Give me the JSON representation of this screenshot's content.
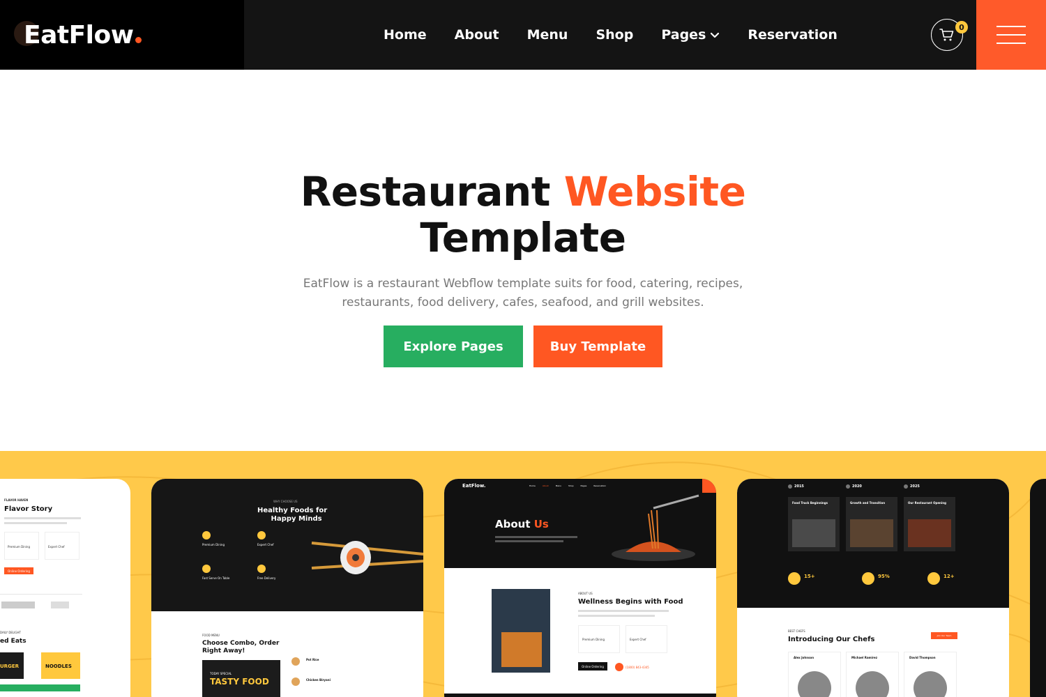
{
  "brand": {
    "logo": "EatFlow",
    "accent_color": "#ff5722"
  },
  "nav": {
    "home": "Home",
    "about": "About",
    "menu": "Menu",
    "shop": "Shop",
    "pages": "Pages",
    "reservation": "Reservation"
  },
  "cart": {
    "count": "0"
  },
  "hero": {
    "title_part1": "Restaurant ",
    "title_accent": "Website",
    "title_part2": "Template",
    "description": "EatFlow is a restaurant Webflow template suits for food, catering, recipes, restaurants, food delivery, cafes, seafood, and grill websites.",
    "explore_button": "Explore Pages",
    "buy_button": "Buy Template"
  },
  "colors": {
    "green": "#27ae60",
    "orange": "#ff5722",
    "yellow": "#ffc94a",
    "dark": "#141414"
  },
  "previews": {
    "card1": {
      "eyebrow": "FLAVOR HAVEN",
      "title": "Flavor Story",
      "feature1": "Premium Dining",
      "feature2": "Expert Chef",
      "cta": "Online Ordering",
      "eyebrow2": "DAILY DELIGHT",
      "title2": "ed Eats",
      "promo1": "URGER",
      "promo2": "NOODLES"
    },
    "card2": {
      "eyebrow": "WHY CHOOSE US",
      "title_line1": "Healthy Foods for",
      "title_line2": "Happy Minds",
      "feature1": "Premium Dining",
      "feature2": "Expert Chef",
      "feature3": "Fast Serve On Table",
      "feature4": "Free Delivery",
      "eyebrow2": "FOOD MENU",
      "title2_line1": "Choose Combo, Order",
      "title2_line2": "Right Away!",
      "promo_small": "TODAY SPECIAL",
      "promo_big": "TASTY FOOD",
      "item1": "Pot Rice",
      "item2": "Chicken Biryani"
    },
    "card3": {
      "logo": "EatFlow.",
      "nav": [
        "Home",
        "About",
        "Menu",
        "Shop",
        "Pages",
        "Reservation"
      ],
      "title": "About",
      "title_accent": "Us",
      "eyebrow2": "ABOUT US",
      "title2": "Wellness Begins with Food",
      "feature1": "Premium Dining",
      "feature2": "Expert Chef",
      "cta": "Online Ordering",
      "phone": "(1800) 843-4345"
    },
    "card4": {
      "year1": "2015",
      "year2": "2020",
      "year3": "2025",
      "step1": "Food Truck Beginnings",
      "step2": "Growth and Transition",
      "step3": "Our Restaurant Opening",
      "stat1": "15+",
      "stat2": "95%",
      "stat3": "12+",
      "eyebrow2": "BEST CHEFS",
      "title2": "Introducing Our Chefs",
      "cta": "Join Our Team",
      "chef1": "Alex Johnson",
      "chef2": "Michael Ramirez",
      "chef3": "David Thompson"
    }
  }
}
